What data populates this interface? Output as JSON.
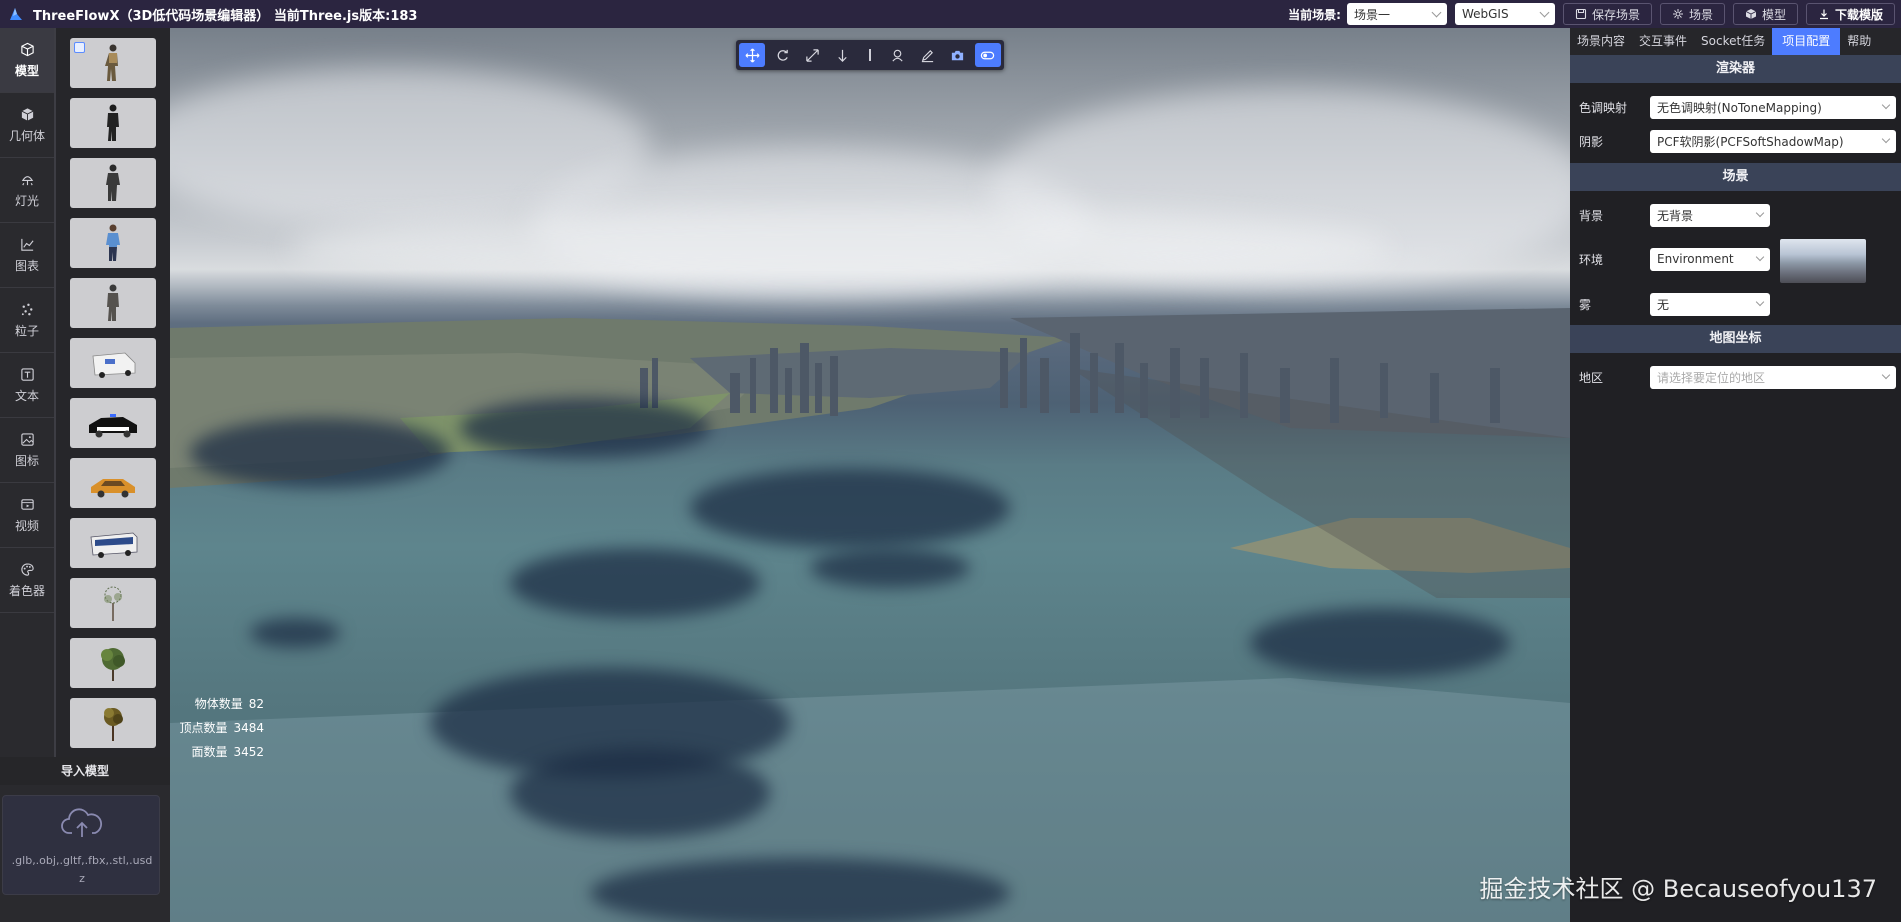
{
  "app": {
    "title": "ThreeFlowX（3D低代码场景编辑器） 当前Three.js版本:183"
  },
  "topbar": {
    "scene_label": "当前场景:",
    "scene_select": "场景一",
    "mode_select": "WebGIS",
    "save_label": "保存场景",
    "scene_button": "场景",
    "model_button": "模型",
    "download_label": "下载模版"
  },
  "nav": {
    "items": [
      {
        "label": "模型",
        "icon": "cube-icon"
      },
      {
        "label": "几何体",
        "icon": "box-icon"
      },
      {
        "label": "灯光",
        "icon": "lamp-icon"
      },
      {
        "label": "图表",
        "icon": "chart-icon"
      },
      {
        "label": "粒子",
        "icon": "particle-icon"
      },
      {
        "label": "文本",
        "icon": "text-icon"
      },
      {
        "label": "图标",
        "icon": "image-icon"
      },
      {
        "label": "视频",
        "icon": "video-icon"
      },
      {
        "label": "着色器",
        "icon": "palette-icon"
      }
    ]
  },
  "models": {
    "thumbnails": [
      "person",
      "person",
      "person",
      "person",
      "person",
      "ambulance",
      "police-car",
      "taxi",
      "bus",
      "tree",
      "tree",
      "tree"
    ]
  },
  "import": {
    "title": "导入模型",
    "formats": ".glb,.obj,.gltf,.fbx,.stl,.usdz"
  },
  "toolbar": {
    "tools": [
      "move-icon",
      "rotate-icon",
      "scale-icon",
      "drop-icon",
      "person-icon",
      "pen-icon",
      "camera-icon",
      "toggle-icon"
    ]
  },
  "stats": {
    "objects_label": "物体数量",
    "objects_value": "82",
    "vertices_label": "顶点数量",
    "vertices_value": "3484",
    "faces_label": "面数量",
    "faces_value": "3452"
  },
  "panel": {
    "tabs": [
      "场景内容",
      "交互事件",
      "Socket任务",
      "项目配置",
      "帮助"
    ],
    "active_tab": "项目配置",
    "renderer": {
      "title": "渲染器",
      "tonemap_label": "色调映射",
      "tonemap_value": "无色调映射(NoToneMapping)",
      "shadow_label": "阴影",
      "shadow_value": "PCF软阴影(PCFSoftShadowMap)"
    },
    "scene": {
      "title": "场景",
      "background_label": "背景",
      "background_value": "无背景",
      "environment_label": "环境",
      "environment_value": "Environment",
      "fog_label": "雾",
      "fog_value": "无"
    },
    "map": {
      "title": "地图坐标",
      "region_label": "地区",
      "region_placeholder": "请选择要定位的地区"
    }
  },
  "watermark": "掘金技术社区 @ Becauseofyou137",
  "colors": {
    "accent": "#4d7cff",
    "topbar": "#2b2540",
    "panel": "#202024",
    "section_header": "#3a4358"
  }
}
